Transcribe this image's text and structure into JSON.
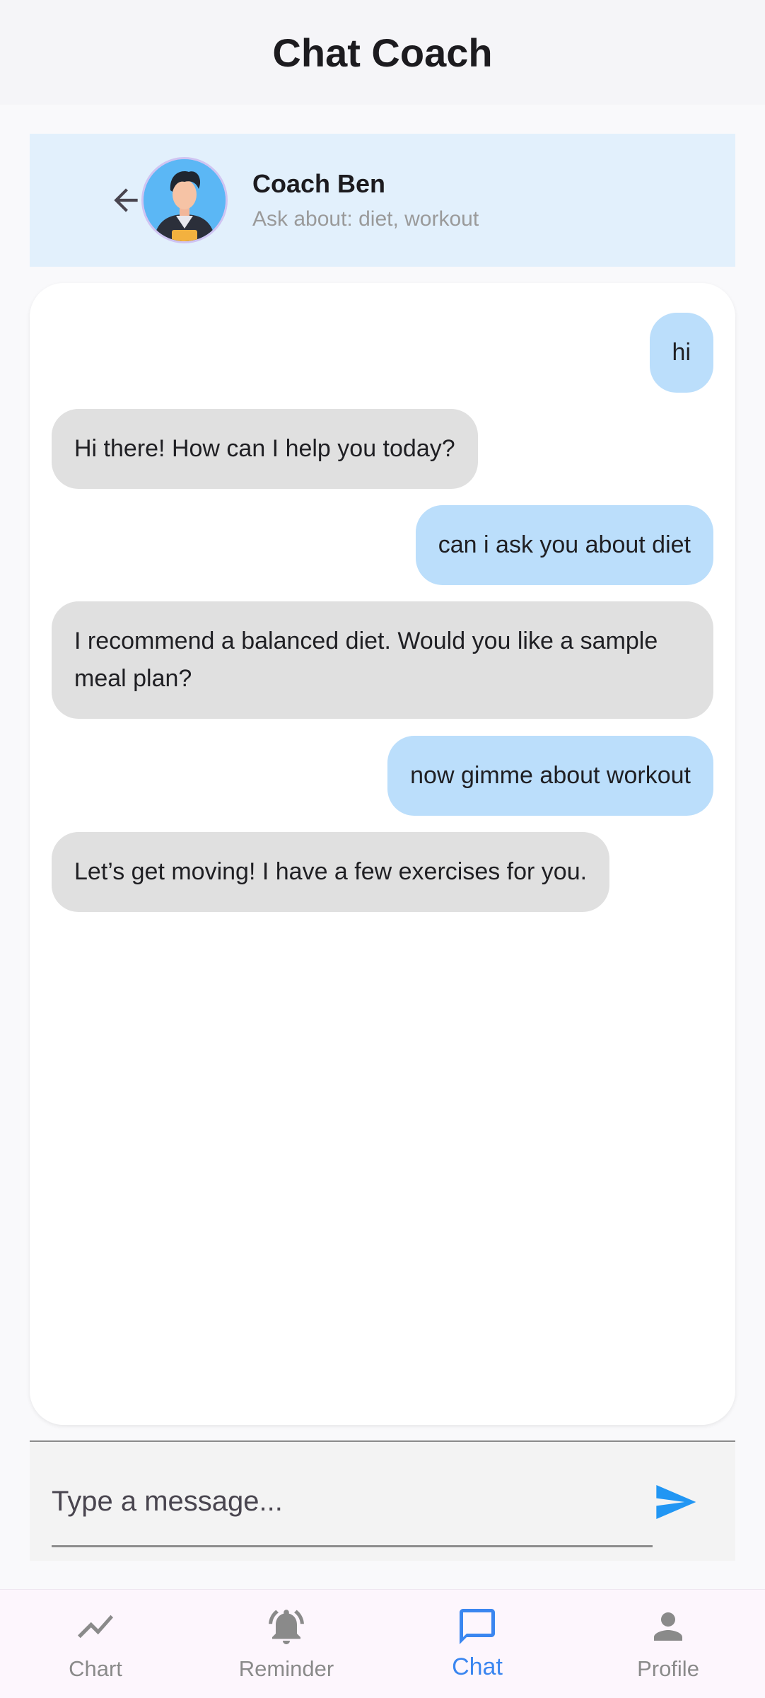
{
  "app": {
    "title": "Chat Coach"
  },
  "coach": {
    "name": "Coach Ben",
    "topics": "Ask about: diet, workout",
    "back_icon": "arrow-left-icon",
    "avatar_icon": "coach-avatar-icon"
  },
  "messages": [
    {
      "sender": "user",
      "text": "hi"
    },
    {
      "sender": "coach",
      "text": "Hi there! How can I help you today?"
    },
    {
      "sender": "user",
      "text": "can i ask you about diet"
    },
    {
      "sender": "coach",
      "text": "I recommend a balanced diet. Would you like a sample meal plan?"
    },
    {
      "sender": "user",
      "text": "now gimme about workout"
    },
    {
      "sender": "coach",
      "text": "Let’s get moving! I have a few exercises for you."
    }
  ],
  "input": {
    "placeholder": "Type a message...",
    "value": "",
    "send_icon": "send-icon"
  },
  "nav": {
    "items": [
      {
        "label": "Chart",
        "icon": "trending-up-icon",
        "active": false
      },
      {
        "label": "Reminder",
        "icon": "notifications-active-icon",
        "active": false
      },
      {
        "label": "Chat",
        "icon": "chat-bubble-icon",
        "active": true
      },
      {
        "label": "Profile",
        "icon": "person-icon",
        "active": false
      }
    ]
  },
  "colors": {
    "user_bubble": "#bbdefb",
    "coach_bubble": "#e0e0e0",
    "header_bg": "#e2f0fc",
    "accent": "#3a86f0",
    "send": "#2196f3"
  }
}
